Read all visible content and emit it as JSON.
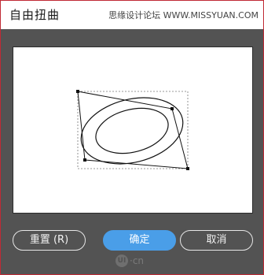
{
  "dialog": {
    "title": "自由扭曲",
    "watermark": "思缘设计论坛 WWW.MISSYUAN.COM"
  },
  "buttons": {
    "reset_label": "重置 (R)",
    "ok_label": "确定",
    "cancel_label": "取消"
  },
  "footer": {
    "logo_text": "UI",
    "logo_suffix": "·cn"
  },
  "colors": {
    "accent": "#4a9ee8",
    "dialog_bg": "#535353",
    "border": "#c02a35"
  }
}
